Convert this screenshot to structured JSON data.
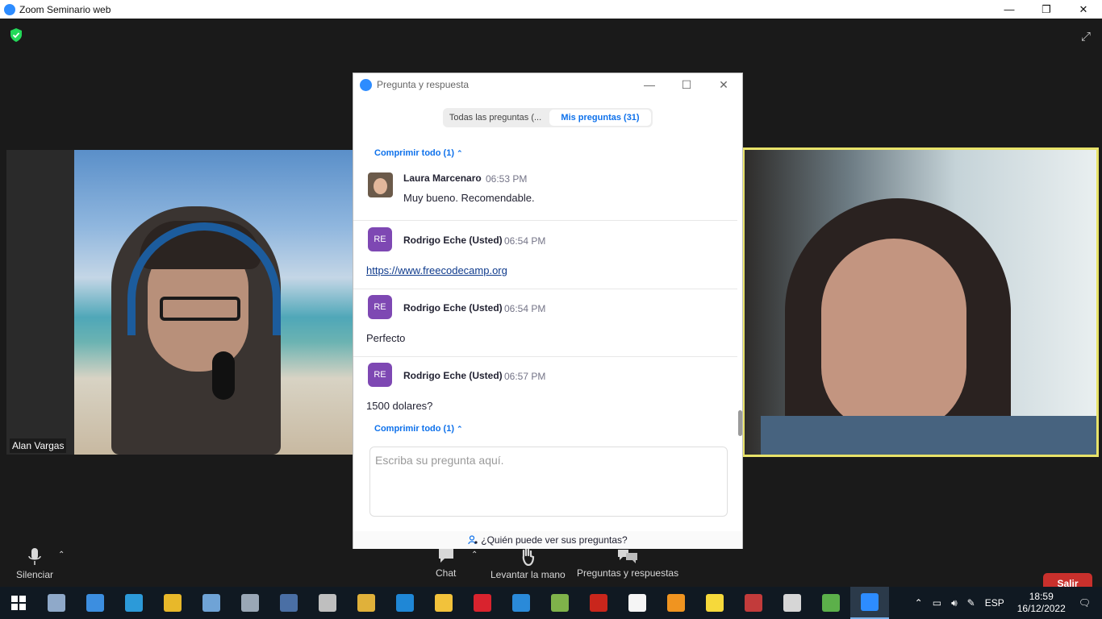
{
  "window": {
    "title": "Zoom Seminario web",
    "minimize": "—",
    "restore": "❐",
    "close": "✕"
  },
  "meeting": {
    "participant_left": "Alan Vargas"
  },
  "qa_window": {
    "title": "Pregunta y respuesta",
    "tabs": [
      {
        "label": "Todas las preguntas (..."
      },
      {
        "label": "Mis preguntas (31)",
        "active": true
      }
    ],
    "collapse_all_top": "Comprimir todo (1)",
    "collapse_all_bottom": "Comprimir todo (1)",
    "messages": [
      {
        "sender": "Laura Marcenaro",
        "time": "06:53 PM",
        "text": "Muy bueno. Recomendable.",
        "avatar": "photo"
      },
      {
        "sender": "Rodrigo Eche (Usted)",
        "time": "06:54 PM",
        "text": "https://www.freecodecamp.org",
        "avatar": "RE",
        "is_link": true
      },
      {
        "sender": "Rodrigo Eche (Usted)",
        "time": "06:54 PM",
        "text": "Perfecto",
        "avatar": "RE"
      },
      {
        "sender": "Rodrigo Eche (Usted)",
        "time": "06:57 PM",
        "text": "1500 dolares?",
        "avatar": "RE"
      }
    ],
    "input_placeholder": "Escriba su pregunta aquí.",
    "who_can_see": "¿Quién puede ver sus preguntas?"
  },
  "controls": {
    "mute": "Silenciar",
    "chat": "Chat",
    "raise_hand": "Levantar la mano",
    "qa": "Preguntas y respuestas",
    "leave": "Salir"
  },
  "taskbar": {
    "language": "ESP",
    "time": "18:59",
    "date": "16/12/2022",
    "apps": [
      {
        "name": "task-manager-icon",
        "color": "#8fa9c9"
      },
      {
        "name": "control-panel-icon",
        "color": "#3c8ee0"
      },
      {
        "name": "sharex-icon",
        "color": "#2c9ad9"
      },
      {
        "name": "star-app-icon",
        "color": "#e8b82a"
      },
      {
        "name": "paint-icon",
        "color": "#6fa3d6"
      },
      {
        "name": "camera-icon",
        "color": "#9aa7b6"
      },
      {
        "name": "calculator-icon",
        "color": "#4a6fa5"
      },
      {
        "name": "wizard-icon",
        "color": "#bfbfbf"
      },
      {
        "name": "circle-app-icon",
        "color": "#e0b13a"
      },
      {
        "name": "h-app-icon",
        "color": "#1f87d6"
      },
      {
        "name": "file-explorer-icon",
        "color": "#f2c23b"
      },
      {
        "name": "opera-icon",
        "color": "#d9232e"
      },
      {
        "name": "vscode-icon",
        "color": "#2a8ad9"
      },
      {
        "name": "notepad-icon",
        "color": "#7fb24a"
      },
      {
        "name": "filezilla-icon",
        "color": "#c9261c"
      },
      {
        "name": "mongodb-icon",
        "color": "#f5f5f5"
      },
      {
        "name": "sublime-icon",
        "color": "#f09420"
      },
      {
        "name": "yellow-app-icon",
        "color": "#f6d93b"
      },
      {
        "name": "red-app-icon",
        "color": "#c23b3b"
      },
      {
        "name": "paint3d-icon",
        "color": "#d6d6d6"
      },
      {
        "name": "colorful-app-icon",
        "color": "#5cb04a"
      },
      {
        "name": "zoom-icon",
        "color": "#2d8cff",
        "active": true
      }
    ]
  }
}
